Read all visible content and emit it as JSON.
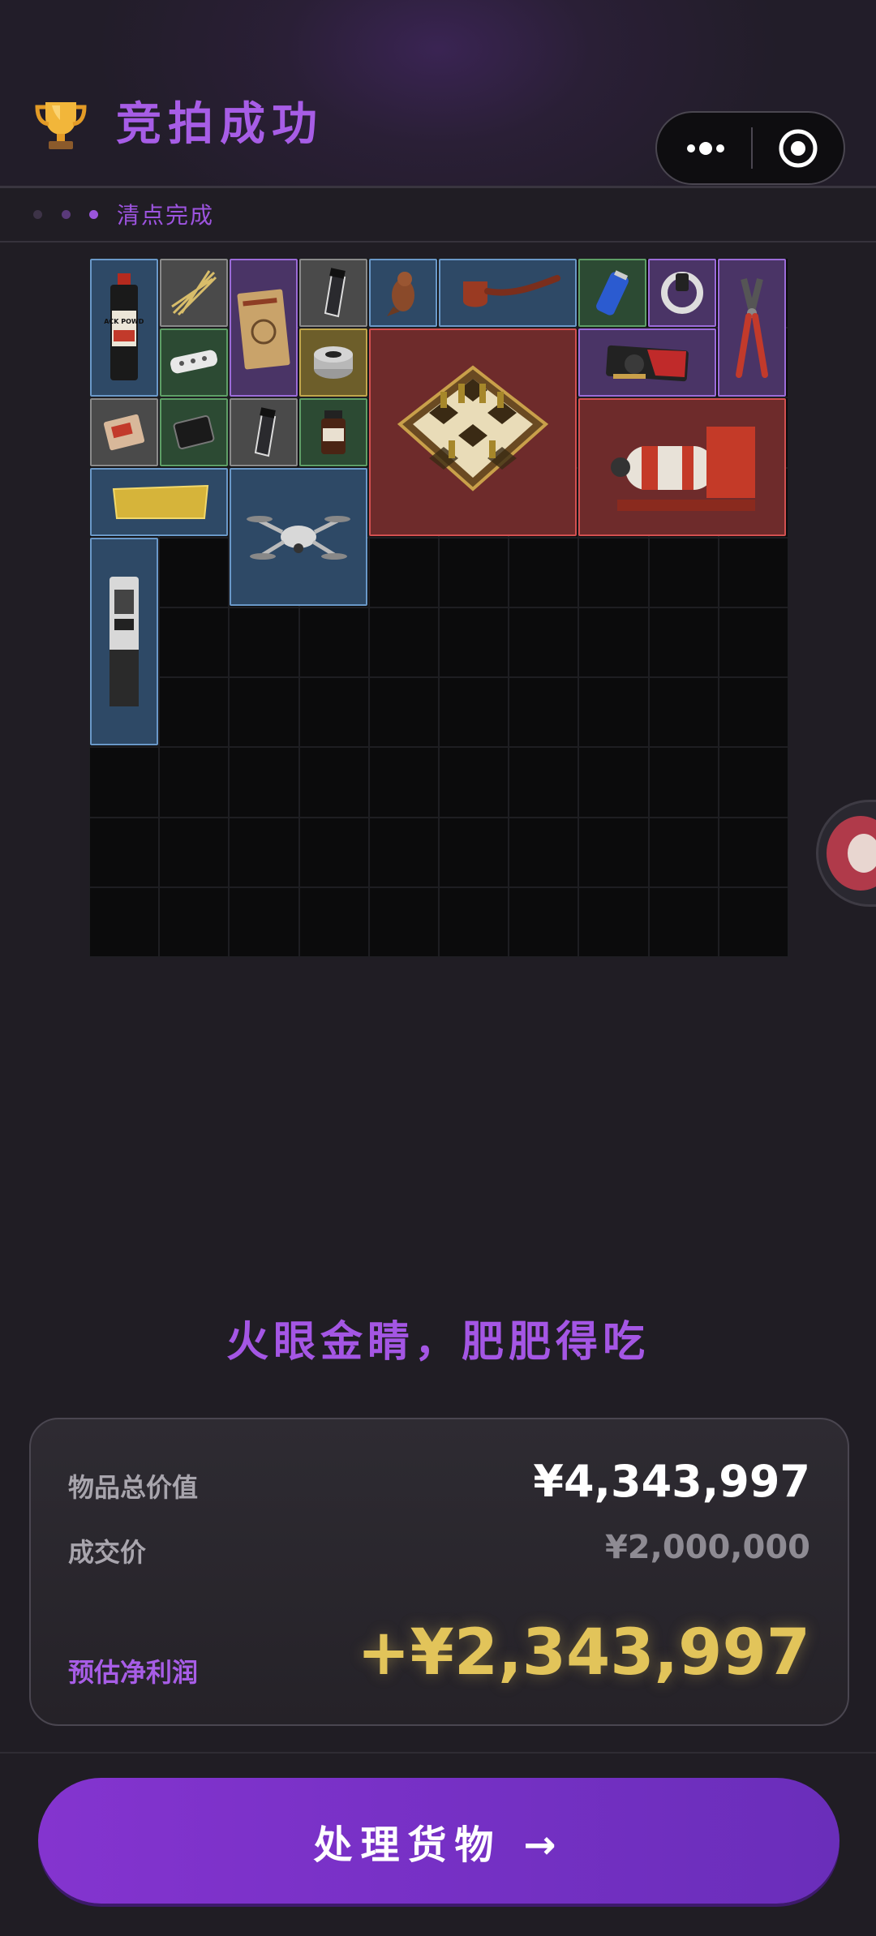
{
  "header": {
    "title": "竞拍成功",
    "trophy_icon": "trophy-icon",
    "more_icon": "more-dots-icon",
    "close_icon": "target-close-icon"
  },
  "status": {
    "dots": [
      "#3d3347",
      "#5a3a7a",
      "#9a55dc"
    ],
    "text": "清点完成"
  },
  "inventory": {
    "columns": 10,
    "rows": 10,
    "items": [
      {
        "name": "black-powder-can",
        "icon": "powder-can-icon",
        "rarity": "blue",
        "label": "BLACK POWDER"
      },
      {
        "name": "rope",
        "icon": "rope-icon",
        "rarity": "gray"
      },
      {
        "name": "old-book",
        "icon": "book-icon",
        "rarity": "purple"
      },
      {
        "name": "pepper-grinder",
        "icon": "grinder-icon",
        "rarity": "gray"
      },
      {
        "name": "bird-figurine",
        "icon": "bird-figurine-icon",
        "rarity": "blue"
      },
      {
        "name": "smoking-pipe",
        "icon": "pipe-icon",
        "rarity": "blue"
      },
      {
        "name": "battery",
        "icon": "battery-icon",
        "rarity": "green"
      },
      {
        "name": "smart-band",
        "icon": "smart-band-icon",
        "rarity": "purple"
      },
      {
        "name": "pliers",
        "icon": "pliers-icon",
        "rarity": "purple"
      },
      {
        "name": "power-strip",
        "icon": "power-strip-icon",
        "rarity": "green"
      },
      {
        "name": "gas-filter",
        "icon": "filter-icon",
        "rarity": "gold"
      },
      {
        "name": "chess-set",
        "icon": "chess-set-icon",
        "rarity": "red"
      },
      {
        "name": "graphics-card",
        "icon": "gpu-icon",
        "rarity": "purple"
      },
      {
        "name": "food-packet",
        "icon": "food-packet-icon",
        "rarity": "gray"
      },
      {
        "name": "hard-drive",
        "icon": "hard-drive-icon",
        "rarity": "green"
      },
      {
        "name": "pepper-grinder-2",
        "icon": "grinder-icon",
        "rarity": "gray"
      },
      {
        "name": "jar",
        "icon": "jar-icon",
        "rarity": "green"
      },
      {
        "name": "gas-tank-machine",
        "icon": "gas-tank-icon",
        "rarity": "red"
      },
      {
        "name": "gold-bar",
        "icon": "gold-bar-icon",
        "rarity": "blue"
      },
      {
        "name": "drone",
        "icon": "drone-icon",
        "rarity": "blue"
      },
      {
        "name": "server-tower",
        "icon": "server-icon",
        "rarity": "blue"
      }
    ]
  },
  "side_button_icon": "meat-icon",
  "slogan": "火眼金睛，肥肥得吃",
  "summary": {
    "total_label": "物品总价值",
    "total_value": "¥4,343,997",
    "deal_label": "成交价",
    "deal_value": "¥2,000,000",
    "profit_label": "预估净利润",
    "profit_value": "+¥2,343,997"
  },
  "colors": {
    "accent": "#a75de6",
    "profit": "#e2c45a",
    "rarity": {
      "blue": "#6a98c8",
      "green": "#5e9e66",
      "purple": "#9b6bd8",
      "gray": "#8a8a8a",
      "gold": "#c1a64c",
      "red": "#d25050"
    }
  },
  "action": {
    "label": "处理货物 →"
  }
}
